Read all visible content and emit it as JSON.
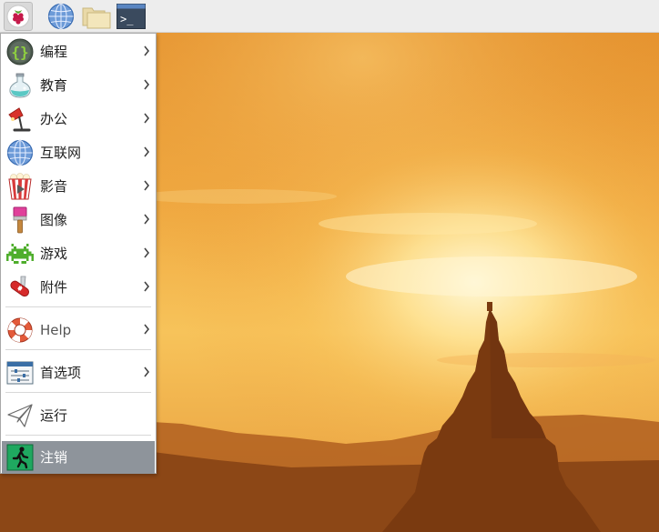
{
  "taskbar": {
    "launchers": [
      {
        "icon": "raspberry-icon"
      },
      {
        "icon": "globe-icon"
      },
      {
        "icon": "folder-icon"
      },
      {
        "icon": "terminal-icon",
        "glyph": ">_"
      }
    ]
  },
  "menu": {
    "items": [
      {
        "label": "编程",
        "icon": "code-braces-icon"
      },
      {
        "label": "教育",
        "icon": "flask-icon"
      },
      {
        "label": "办公",
        "icon": "desk-lamp-icon"
      },
      {
        "label": "互联网",
        "icon": "globe-icon"
      },
      {
        "label": "影音",
        "icon": "popcorn-play-icon"
      },
      {
        "label": "图像",
        "icon": "paintbrush-icon"
      },
      {
        "label": "游戏",
        "icon": "space-invader-icon"
      },
      {
        "label": "附件",
        "icon": "pocket-knife-icon"
      },
      {
        "label": "Help",
        "icon": "lifebuoy-icon"
      },
      {
        "label": "首选项",
        "icon": "settings-panel-icon"
      },
      {
        "label": "运行",
        "icon": "paper-plane-icon"
      },
      {
        "label": "注销",
        "icon": "exit-running-icon"
      }
    ]
  },
  "colors": {
    "taskbar_bg": "#ededed",
    "menu_bg": "#ffffff",
    "selected_bg": "#8e949b",
    "sky_top": "#e89a2f",
    "sun_glow": "#fff4c8"
  }
}
